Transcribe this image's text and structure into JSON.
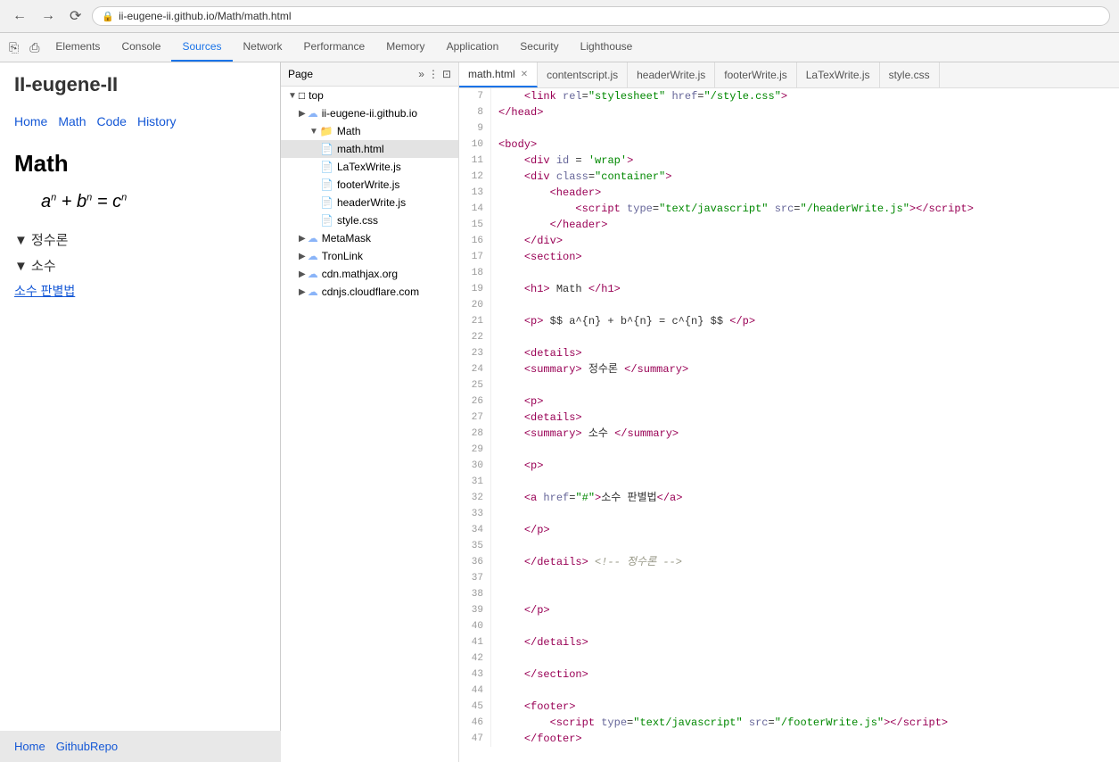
{
  "browser": {
    "back_label": "←",
    "forward_label": "→",
    "reload_label": "↺",
    "url": "ii-eugene-ii.github.io/Math/math.html",
    "lock_icon": "🔒"
  },
  "devtools": {
    "tabs": [
      "Elements",
      "Console",
      "Sources",
      "Network",
      "Performance",
      "Memory",
      "Application",
      "Security",
      "Lighthouse"
    ],
    "active_tab": "Sources"
  },
  "website": {
    "title": "II-eugene-II",
    "nav": [
      "Home",
      "Math",
      "Code",
      "History"
    ],
    "page_title": "Math",
    "footer_links": [
      "Home",
      "GithubRepo"
    ]
  },
  "file_tree": {
    "page_label": "Page",
    "items": [
      {
        "id": "top",
        "label": "top",
        "indent": 1,
        "type": "folder",
        "arrow": "▼"
      },
      {
        "id": "ii-eugene",
        "label": "ii-eugene-ii.github.io",
        "indent": 2,
        "type": "cloud",
        "arrow": "▶"
      },
      {
        "id": "math-folder",
        "label": "Math",
        "indent": 3,
        "type": "folder",
        "arrow": "▼"
      },
      {
        "id": "math-html",
        "label": "math.html",
        "indent": 4,
        "type": "file-html",
        "selected": true
      },
      {
        "id": "latex",
        "label": "LaTexWrite.js",
        "indent": 4,
        "type": "file-js"
      },
      {
        "id": "footer",
        "label": "footerWrite.js",
        "indent": 4,
        "type": "file-js"
      },
      {
        "id": "header",
        "label": "headerWrite.js",
        "indent": 4,
        "type": "file-js"
      },
      {
        "id": "style",
        "label": "style.css",
        "indent": 4,
        "type": "file-css"
      },
      {
        "id": "metamask",
        "label": "MetaMask",
        "indent": 2,
        "type": "cloud",
        "arrow": "▶"
      },
      {
        "id": "tronlink",
        "label": "TronLink",
        "indent": 2,
        "type": "cloud",
        "arrow": "▶"
      },
      {
        "id": "mathjax",
        "label": "cdn.mathjax.org",
        "indent": 2,
        "type": "cloud",
        "arrow": "▶"
      },
      {
        "id": "cloudflare",
        "label": "cdnjs.cloudflare.com",
        "indent": 2,
        "type": "cloud",
        "arrow": "▶"
      }
    ]
  },
  "source_tabs": [
    {
      "label": "math.html",
      "active": true,
      "closeable": true
    },
    {
      "label": "contentscript.js",
      "active": false
    },
    {
      "label": "headerWrite.js",
      "active": false
    },
    {
      "label": "footerWrite.js",
      "active": false
    },
    {
      "label": "LaTexWrite.js",
      "active": false
    },
    {
      "label": "style.css",
      "active": false
    }
  ],
  "code_lines": [
    {
      "num": 7,
      "html": "    &lt;<span class='tag'>link</span> <span class='attr'>rel</span>=<span class='string'>\"stylesheet\"</span> <span class='attr'>href</span>=<span class='string'>\"/style.css\"</span>&gt;"
    },
    {
      "num": 8,
      "html": "<span class='tag'>&lt;/head&gt;</span>"
    },
    {
      "num": 9,
      "html": ""
    },
    {
      "num": 10,
      "html": "<span class='tag'>&lt;body&gt;</span>"
    },
    {
      "num": 11,
      "html": "    &lt;<span class='tag'>div</span> <span class='attr'>id</span> = <span class='string'>'wrap'</span>&gt;"
    },
    {
      "num": 12,
      "html": "    &lt;<span class='tag'>div</span> <span class='attr'>class</span>=<span class='string'>\"container\"</span>&gt;"
    },
    {
      "num": 13,
      "html": "        &lt;<span class='tag'>header</span>&gt;"
    },
    {
      "num": 14,
      "html": "            &lt;<span class='tag'>script</span> <span class='attr'>type</span>=<span class='string'>\"text/javascript\"</span> <span class='attr'>src</span>=<span class='string'>\"/headerWrite.js\"</span>&gt;&lt;/<span class='tag'>script</span>&gt;"
    },
    {
      "num": 15,
      "html": "        &lt;/<span class='tag'>header</span>&gt;"
    },
    {
      "num": 16,
      "html": "    &lt;/<span class='tag'>div</span>&gt;"
    },
    {
      "num": 17,
      "html": "    &lt;<span class='tag'>section</span>&gt;"
    },
    {
      "num": 18,
      "html": ""
    },
    {
      "num": 19,
      "html": "    &lt;<span class='tag'>h1</span>&gt; Math &lt;/<span class='tag'>h1</span>&gt;"
    },
    {
      "num": 20,
      "html": ""
    },
    {
      "num": 21,
      "html": "    &lt;<span class='tag'>p</span>&gt; $$ a^{n} + b^{n} = c^{n} $$ &lt;/<span class='tag'>p</span>&gt;"
    },
    {
      "num": 22,
      "html": ""
    },
    {
      "num": 23,
      "html": "    &lt;<span class='tag'>details</span>&gt;"
    },
    {
      "num": 24,
      "html": "    &lt;<span class='tag'>summary</span>&gt; 정수론 &lt;/<span class='tag'>summary</span>&gt;"
    },
    {
      "num": 25,
      "html": ""
    },
    {
      "num": 26,
      "html": "    &lt;<span class='tag'>p</span>&gt;"
    },
    {
      "num": 27,
      "html": "    &lt;<span class='tag'>details</span>&gt;"
    },
    {
      "num": 28,
      "html": "    &lt;<span class='tag'>summary</span>&gt; 소수 &lt;/<span class='tag'>summary</span>&gt;"
    },
    {
      "num": 29,
      "html": ""
    },
    {
      "num": 30,
      "html": "    &lt;<span class='tag'>p</span>&gt;"
    },
    {
      "num": 31,
      "html": ""
    },
    {
      "num": 32,
      "html": "    &lt;<span class='tag'>a</span> <span class='attr'>href</span>=<span class='string'>\"#\"</span>&gt;소수 판별법&lt;/<span class='tag'>a</span>&gt;"
    },
    {
      "num": 33,
      "html": ""
    },
    {
      "num": 34,
      "html": "    &lt;/<span class='tag'>p</span>&gt;"
    },
    {
      "num": 35,
      "html": ""
    },
    {
      "num": 36,
      "html": "    &lt;/<span class='tag'>details</span>&gt; <span class='comment'>&lt;!-- 정수론 --&gt;</span>"
    },
    {
      "num": 37,
      "html": ""
    },
    {
      "num": 38,
      "html": ""
    },
    {
      "num": 39,
      "html": "    &lt;/<span class='tag'>p</span>&gt;"
    },
    {
      "num": 40,
      "html": ""
    },
    {
      "num": 41,
      "html": "    &lt;/<span class='tag'>details</span>&gt;"
    },
    {
      "num": 42,
      "html": ""
    },
    {
      "num": 43,
      "html": "    &lt;/<span class='tag'>section</span>&gt;"
    },
    {
      "num": 44,
      "html": ""
    },
    {
      "num": 45,
      "html": "    &lt;<span class='tag'>footer</span>&gt;"
    },
    {
      "num": 46,
      "html": "        &lt;<span class='tag'>script</span> <span class='attr'>type</span>=<span class='string'>\"text/javascript\"</span> <span class='attr'>src</span>=<span class='string'>\"/footerWrite.js\"</span>&gt;&lt;/<span class='tag'>script</span>&gt;"
    },
    {
      "num": 47,
      "html": "    &lt;/<span class='tag'>footer</span>&gt;"
    }
  ]
}
